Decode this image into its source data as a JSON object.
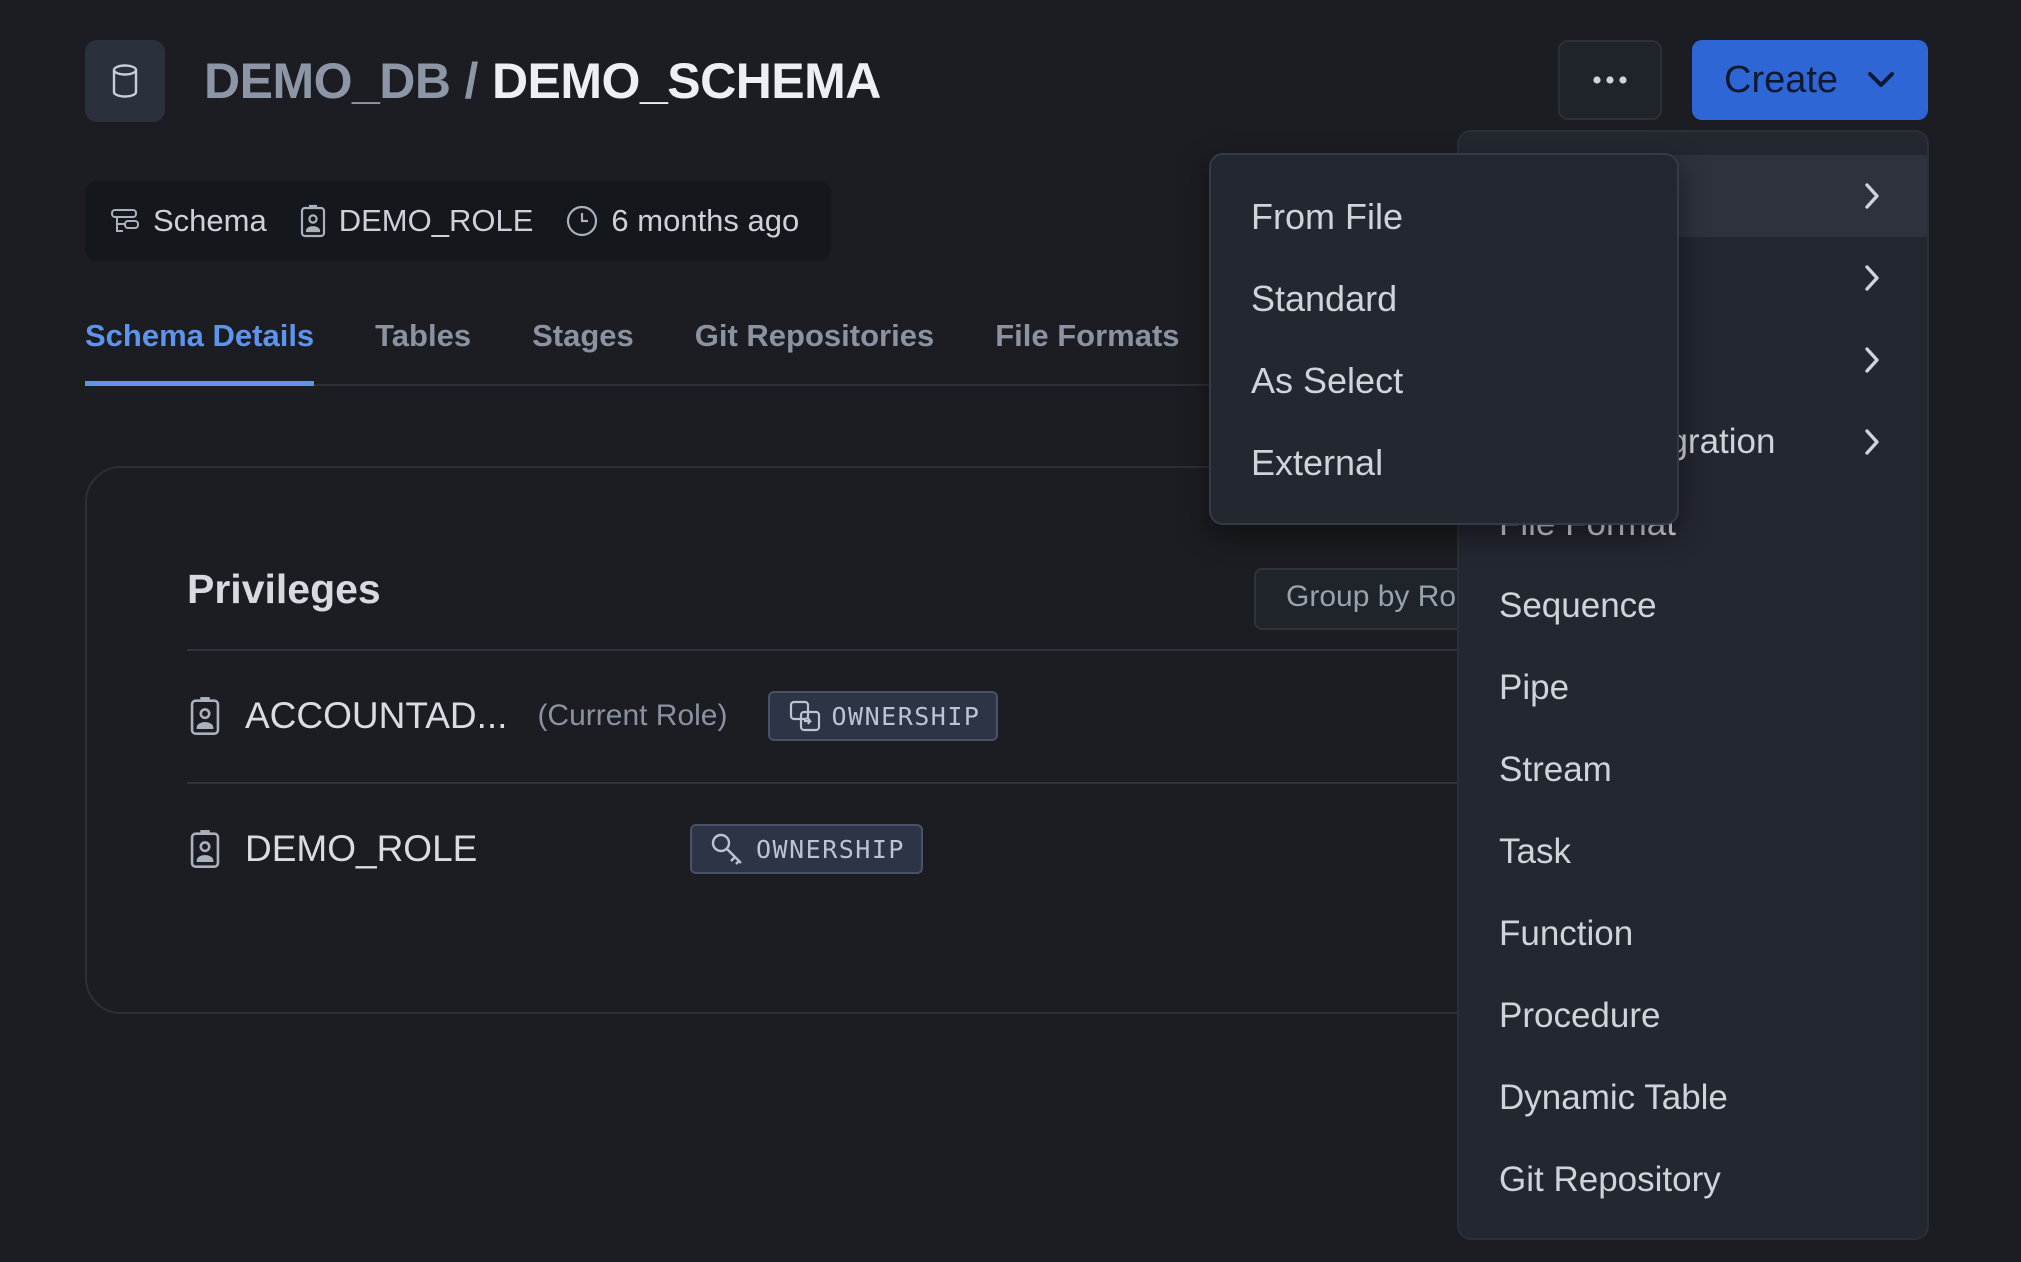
{
  "header": {
    "database": "DEMO_DB",
    "separator": "/",
    "schema": "DEMO_SCHEMA",
    "db_icon": "database-icon",
    "more_icon": "ellipsis-icon",
    "create_label": "Create",
    "create_icon": "chevron-down-icon",
    "accent_color": "#2f66d6"
  },
  "meta": {
    "type_label": "Schema",
    "owner_role": "DEMO_ROLE",
    "modified": "6 months ago"
  },
  "tabs": [
    {
      "label": "Schema Details",
      "active": true
    },
    {
      "label": "Tables"
    },
    {
      "label": "Stages"
    },
    {
      "label": "Git Repositories"
    },
    {
      "label": "File Formats"
    }
  ],
  "privileges": {
    "title": "Privileges",
    "group_by_label": "Group by Ro",
    "rows": [
      {
        "role": "ACCOUNTAD...",
        "note": "(Current Role)",
        "badge": "OWNERSHIP",
        "badge_icon": "transfer-icon"
      },
      {
        "role": "DEMO_ROLE",
        "note": "",
        "badge": "OWNERSHIP",
        "badge_icon": "key-icon"
      }
    ]
  },
  "create_menu": {
    "items": [
      {
        "label": "",
        "has_submenu": true,
        "highlighted": true
      },
      {
        "label": "",
        "has_submenu": true
      },
      {
        "label": "",
        "has_submenu": true
      },
      {
        "label": "egration",
        "has_submenu": true
      },
      {
        "label": "File Format"
      },
      {
        "label": "Sequence"
      },
      {
        "label": "Pipe"
      },
      {
        "label": "Stream"
      },
      {
        "label": "Task"
      },
      {
        "label": "Function"
      },
      {
        "label": "Procedure"
      },
      {
        "label": "Dynamic Table"
      },
      {
        "label": "Git Repository"
      }
    ]
  },
  "table_submenu": {
    "items": [
      "From File",
      "Standard",
      "As Select",
      "External"
    ]
  }
}
